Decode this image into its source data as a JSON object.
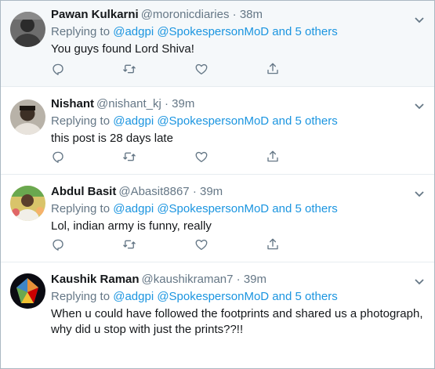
{
  "reply_prefix": "Replying to",
  "tweets": [
    {
      "name": "Pawan Kulkarni",
      "handle": "@moronicdiaries",
      "separator": "·",
      "time": "38m",
      "mentions": [
        "@adgpi",
        "@SpokespersonMoD",
        "and 5 others"
      ],
      "text": "You guys found Lord Shiva!",
      "highlighted": true
    },
    {
      "name": "Nishant",
      "handle": "@nishant_kj",
      "separator": "·",
      "time": "39m",
      "mentions": [
        "@adgpi",
        "@SpokespersonMoD",
        "and 5 others"
      ],
      "text": "this post is 28 days late"
    },
    {
      "name": "Abdul Basit",
      "handle": "@Abasit8867",
      "separator": "·",
      "time": "39m",
      "mentions": [
        "@adgpi",
        "@SpokespersonMoD",
        "and 5 others"
      ],
      "text": "Lol, indian army is funny, really"
    },
    {
      "name": "Kaushik Raman",
      "handle": "@kaushikraman7",
      "separator": "·",
      "time": "39m",
      "mentions": [
        "@adgpi",
        "@SpokespersonMoD",
        "and 5 others"
      ],
      "text": "When u could have followed the footprints and shared us a photograph, why did u stop with just the prints??!!"
    }
  ],
  "icons": [
    "reply-icon",
    "retweet-icon",
    "like-icon",
    "share-icon",
    "chevron-down-icon"
  ],
  "colors": {
    "link": "#1b95e0",
    "muted": "#657786",
    "text": "#14171a",
    "highlight_bg": "#f5f8fa"
  }
}
